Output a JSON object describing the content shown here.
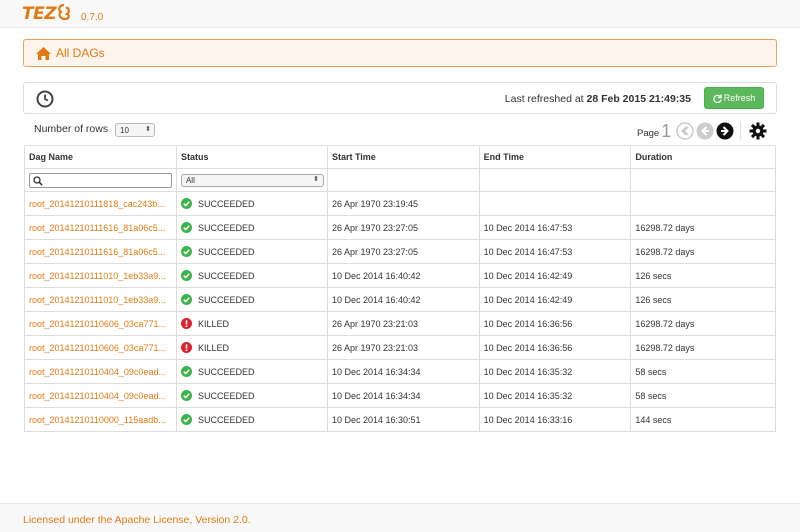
{
  "app": {
    "logo_text": "TEZ",
    "version": "0.7.0"
  },
  "breadcrumb": {
    "title": "All DAGs"
  },
  "refresh": {
    "prefix": "Last refreshed at",
    "timestamp": "28 Feb 2015 21:49:35",
    "button_label": "Refresh"
  },
  "controls": {
    "rows_label": "Number of rows",
    "rows_value": "10",
    "page_label": "Page",
    "page_number": "1"
  },
  "table": {
    "columns": [
      "Dag Name",
      "Status",
      "Start Time",
      "End Time",
      "Duration"
    ],
    "status_filter": "All",
    "rows": [
      {
        "name": "root_20141210111818_cac243b...",
        "status": "SUCCEEDED",
        "start": "26 Apr 1970 23:19:45",
        "end": "",
        "duration": ""
      },
      {
        "name": "root_20141210111616_81a06c5...",
        "status": "SUCCEEDED",
        "start": "26 Apr 1970 23:27:05",
        "end": "10 Dec 2014 16:47:53",
        "duration": "16298.72 days"
      },
      {
        "name": "root_20141210111616_81a06c5...",
        "status": "SUCCEEDED",
        "start": "26 Apr 1970 23:27:05",
        "end": "10 Dec 2014 16:47:53",
        "duration": "16298.72 days"
      },
      {
        "name": "root_20141210111010_1eb33a9...",
        "status": "SUCCEEDED",
        "start": "10 Dec 2014 16:40:42",
        "end": "10 Dec 2014 16:42:49",
        "duration": "126 secs"
      },
      {
        "name": "root_20141210111010_1eb33a9...",
        "status": "SUCCEEDED",
        "start": "10 Dec 2014 16:40:42",
        "end": "10 Dec 2014 16:42:49",
        "duration": "126 secs"
      },
      {
        "name": "root_20141210110606_03ca771...",
        "status": "KILLED",
        "start": "26 Apr 1970 23:21:03",
        "end": "10 Dec 2014 16:36:56",
        "duration": "16298.72 days"
      },
      {
        "name": "root_20141210110606_03ca771...",
        "status": "KILLED",
        "start": "26 Apr 1970 23:21:03",
        "end": "10 Dec 2014 16:36:56",
        "duration": "16298.72 days"
      },
      {
        "name": "root_20141210110404_09c0ead...",
        "status": "SUCCEEDED",
        "start": "10 Dec 2014 16:34:34",
        "end": "10 Dec 2014 16:35:32",
        "duration": "58 secs"
      },
      {
        "name": "root_20141210110404_09c0ead...",
        "status": "SUCCEEDED",
        "start": "10 Dec 2014 16:34:34",
        "end": "10 Dec 2014 16:35:32",
        "duration": "58 secs"
      },
      {
        "name": "root_20141210110000_115aadb...",
        "status": "SUCCEEDED",
        "start": "10 Dec 2014 16:30:51",
        "end": "10 Dec 2014 16:33:16",
        "duration": "144 secs"
      }
    ]
  },
  "footer": {
    "license_text": "Licensed under the Apache License, Version 2.0."
  },
  "colors": {
    "accent": "#e07b14",
    "success": "#3bb54a",
    "killed": "#d9232d",
    "refresh_button": "#5cb85c"
  }
}
